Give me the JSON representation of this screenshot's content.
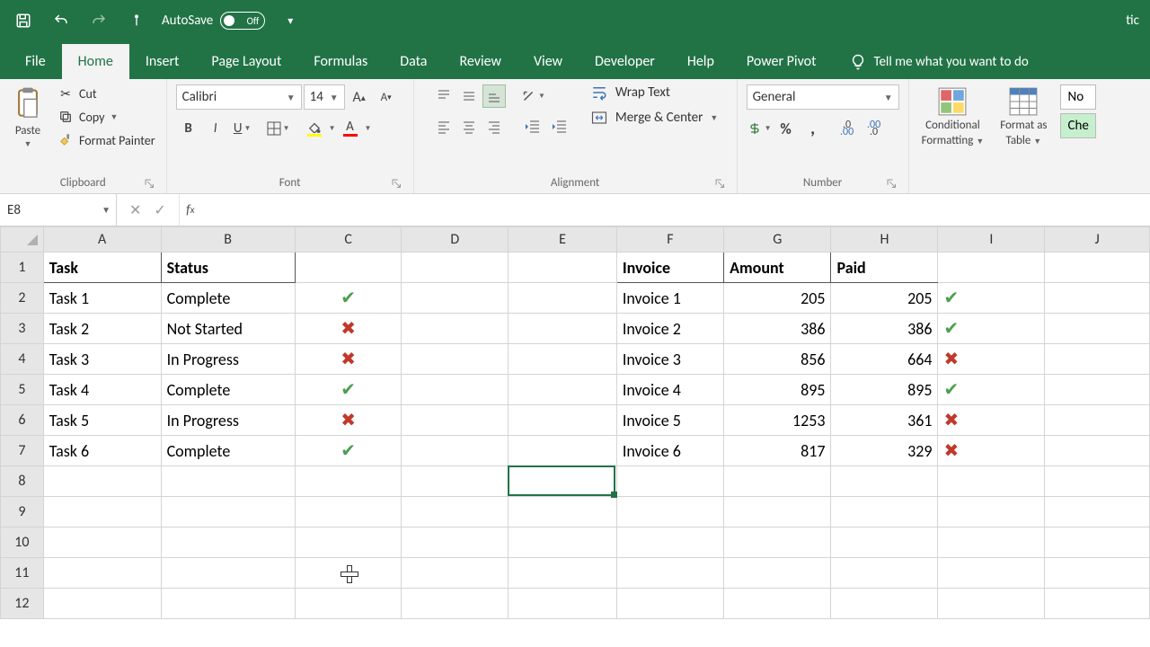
{
  "qat": {
    "autosave_label": "AutoSave",
    "autosave_state": "Off"
  },
  "title_right_fragment": "tic",
  "tabs": {
    "file": "File",
    "home": "Home",
    "insert": "Insert",
    "page_layout": "Page Layout",
    "formulas": "Formulas",
    "data": "Data",
    "review": "Review",
    "view": "View",
    "developer": "Developer",
    "help": "Help",
    "power_pivot": "Power Pivot",
    "tell_me": "Tell me what you want to do"
  },
  "ribbon": {
    "clipboard": {
      "label": "Clipboard",
      "paste": "Paste",
      "cut": "Cut",
      "copy": "Copy",
      "format_painter": "Format Painter"
    },
    "font": {
      "label": "Font",
      "name": "Calibri",
      "size": "14"
    },
    "alignment": {
      "label": "Alignment",
      "wrap": "Wrap Text",
      "merge": "Merge & Center"
    },
    "number": {
      "label": "Number",
      "format": "General"
    },
    "styles": {
      "conditional": "Conditional",
      "formatting": "Formatting",
      "format_as": "Format as",
      "table": "Table",
      "normal": "No",
      "check": "Che"
    }
  },
  "name_box": "E8",
  "formula": "",
  "columns": [
    "A",
    "B",
    "C",
    "D",
    "E",
    "F",
    "G",
    "H",
    "I",
    "J"
  ],
  "row_numbers": [
    "1",
    "2",
    "3",
    "4",
    "5",
    "6",
    "7",
    "8",
    "9",
    "10",
    "11",
    "12"
  ],
  "selected_col": "E",
  "selected_row": "8",
  "headers_left": {
    "A1": "Task",
    "B1": "Status"
  },
  "headers_right": {
    "F1": "Invoice",
    "G1": "Amount",
    "H1": "Paid"
  },
  "tasks": [
    {
      "task": "Task 1",
      "status": "Complete",
      "icon": "check"
    },
    {
      "task": "Task 2",
      "status": "Not Started",
      "icon": "cross"
    },
    {
      "task": "Task 3",
      "status": "In Progress",
      "icon": "cross"
    },
    {
      "task": "Task 4",
      "status": "Complete",
      "icon": "check"
    },
    {
      "task": "Task 5",
      "status": "In Progress",
      "icon": "cross"
    },
    {
      "task": "Task 6",
      "status": "Complete",
      "icon": "check"
    }
  ],
  "invoices": [
    {
      "invoice": "Invoice 1",
      "amount": "205",
      "paid": "205",
      "icon": "check"
    },
    {
      "invoice": "Invoice 2",
      "amount": "386",
      "paid": "386",
      "icon": "check"
    },
    {
      "invoice": "Invoice 3",
      "amount": "856",
      "paid": "664",
      "icon": "cross"
    },
    {
      "invoice": "Invoice 4",
      "amount": "895",
      "paid": "895",
      "icon": "check"
    },
    {
      "invoice": "Invoice 5",
      "amount": "1253",
      "paid": "361",
      "icon": "cross"
    },
    {
      "invoice": "Invoice 6",
      "amount": "817",
      "paid": "329",
      "icon": "cross"
    }
  ]
}
